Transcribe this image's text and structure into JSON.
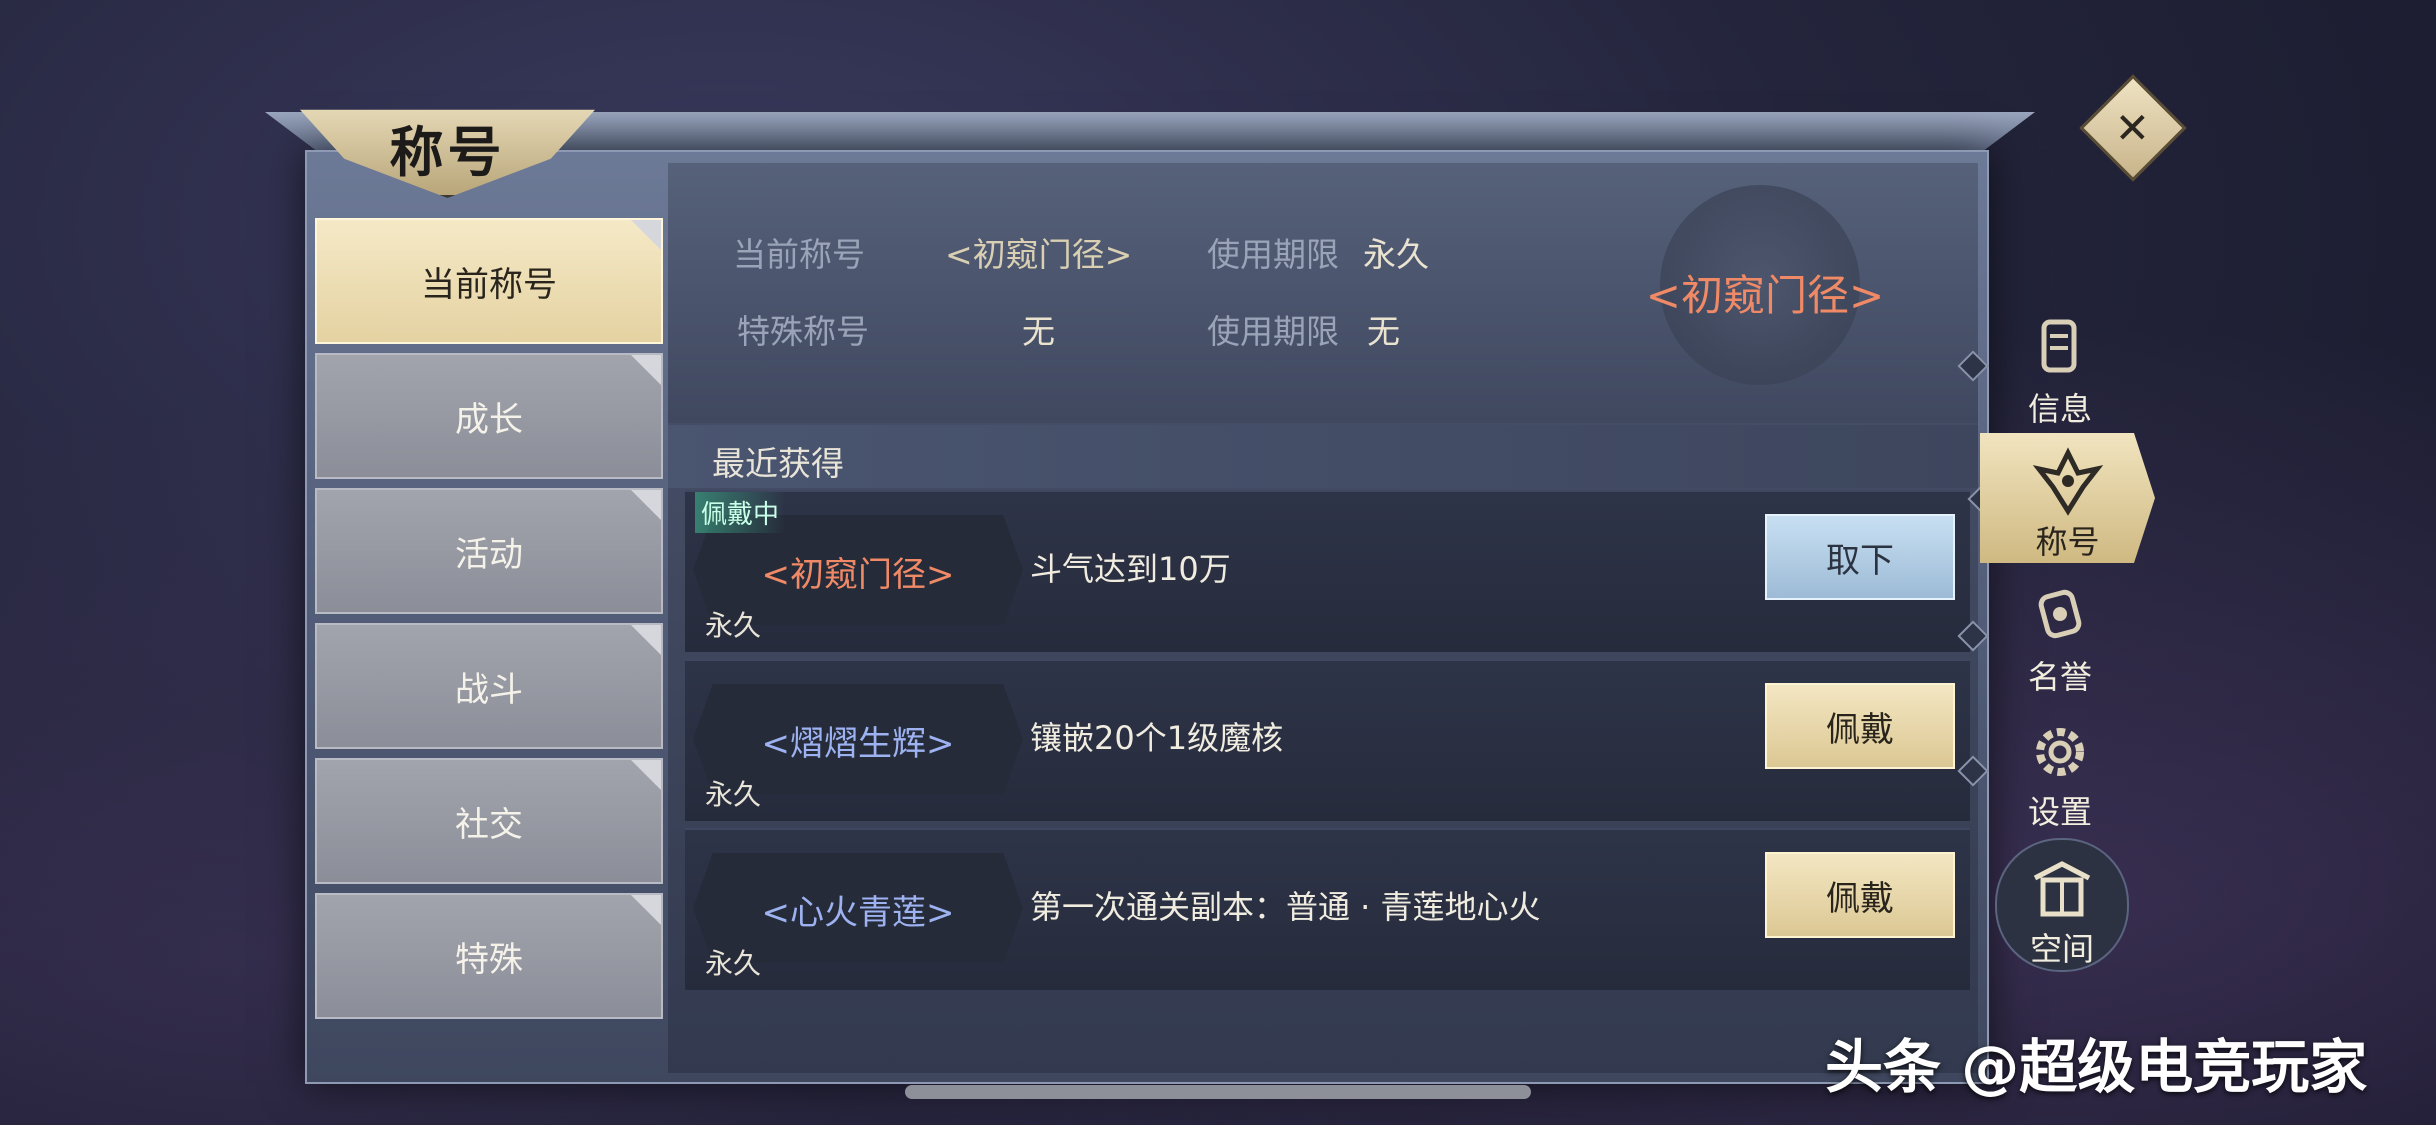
{
  "window": {
    "title": "称号",
    "close_label": "✕"
  },
  "categories": [
    {
      "label": "当前称号",
      "active": true
    },
    {
      "label": "成长",
      "active": false
    },
    {
      "label": "活动",
      "active": false
    },
    {
      "label": "战斗",
      "active": false
    },
    {
      "label": "社交",
      "active": false
    },
    {
      "label": "特殊",
      "active": false
    }
  ],
  "current": {
    "current_title_label": "当前称号",
    "current_title_value": "<初窥门径>",
    "current_period_label": "使用期限",
    "current_period_value": "永久",
    "special_title_label": "特殊称号",
    "special_title_value": "无",
    "special_period_label": "使用期限",
    "special_period_value": "无",
    "display_title": "<初窥门径>"
  },
  "recent": {
    "heading": "最近获得",
    "rows": [
      {
        "badge": "佩戴中",
        "name": "<初窥门径>",
        "duration": "永久",
        "condition": "斗气达到10万",
        "button": "取下"
      },
      {
        "badge": "",
        "name": "<熠熠生辉>",
        "duration": "永久",
        "condition": "镶嵌20个1级魔核",
        "button": "佩戴"
      },
      {
        "badge": "",
        "name": "<心火青莲>",
        "duration": "永久",
        "condition": "第一次通关副本：普通 · 青莲地心火",
        "button": "佩戴"
      }
    ]
  },
  "side_nav": [
    {
      "label": "信息",
      "icon": "scroll-icon",
      "active": false
    },
    {
      "label": "称号",
      "icon": "crest-icon",
      "active": true
    },
    {
      "label": "名誉",
      "icon": "medal-icon",
      "active": false
    },
    {
      "label": "设置",
      "icon": "gear-icon",
      "active": false
    },
    {
      "label": "空间",
      "icon": "gate-icon",
      "active": false
    }
  ],
  "watermark": "头条 @超级电竞玩家",
  "colors": {
    "title_orange": "#f08a66",
    "title_blue": "#9db2f0",
    "accent_gold": "#e4d2a2"
  }
}
